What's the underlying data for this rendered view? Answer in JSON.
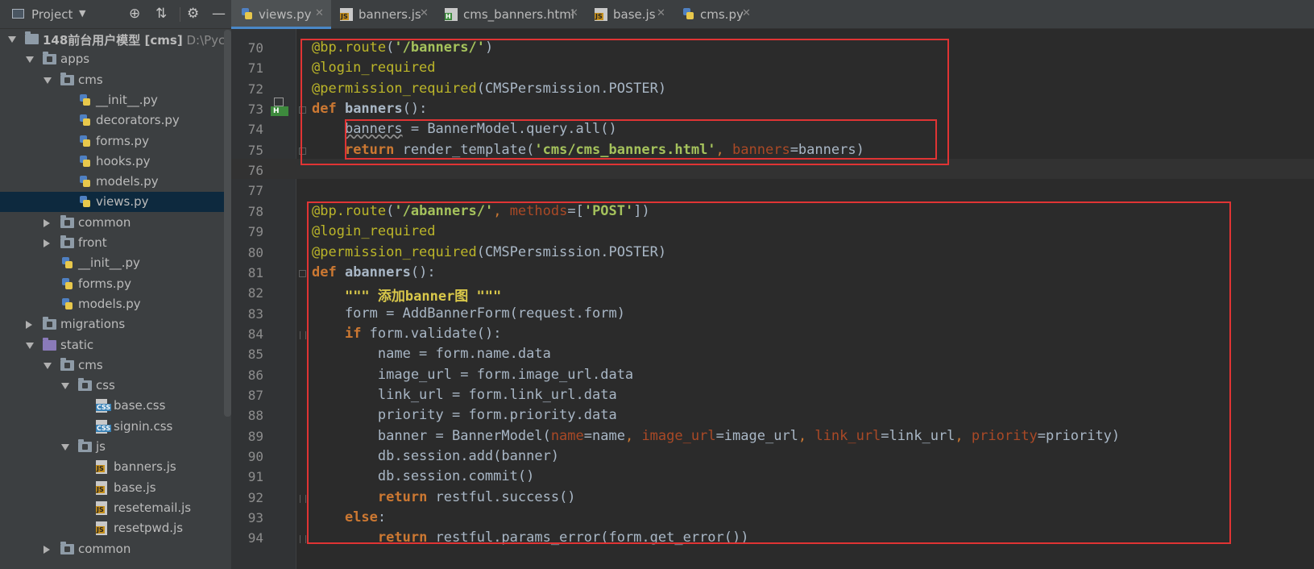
{
  "sidebar": {
    "title": "Project",
    "tree": [
      {
        "label": "148前台用户模型 [cms]",
        "hint": "D:\\Pycharm",
        "type": "folder",
        "expanded": true,
        "depth": 0
      },
      {
        "label": "apps",
        "type": "folder",
        "expanded": true,
        "depth": 1
      },
      {
        "label": "cms",
        "type": "folder",
        "expanded": true,
        "depth": 2
      },
      {
        "label": "__init__.py",
        "type": "py",
        "depth": 3
      },
      {
        "label": "decorators.py",
        "type": "py",
        "depth": 3
      },
      {
        "label": "forms.py",
        "type": "py",
        "depth": 3
      },
      {
        "label": "hooks.py",
        "type": "py",
        "depth": 3
      },
      {
        "label": "models.py",
        "type": "py",
        "depth": 3
      },
      {
        "label": "views.py",
        "type": "py",
        "depth": 3,
        "selected": true
      },
      {
        "label": "common",
        "type": "folder",
        "expanded": false,
        "depth": 2
      },
      {
        "label": "front",
        "type": "folder",
        "expanded": false,
        "depth": 2
      },
      {
        "label": "__init__.py",
        "type": "py",
        "depth": 2
      },
      {
        "label": "forms.py",
        "type": "py",
        "depth": 2
      },
      {
        "label": "models.py",
        "type": "py",
        "depth": 2
      },
      {
        "label": "migrations",
        "type": "folder",
        "expanded": false,
        "depth": 1
      },
      {
        "label": "static",
        "type": "static-folder",
        "expanded": true,
        "depth": 1
      },
      {
        "label": "cms",
        "type": "folder",
        "expanded": true,
        "depth": 2
      },
      {
        "label": "css",
        "type": "folder",
        "expanded": true,
        "depth": 3
      },
      {
        "label": "base.css",
        "type": "css",
        "depth": 4
      },
      {
        "label": "signin.css",
        "type": "css",
        "depth": 4
      },
      {
        "label": "js",
        "type": "folder",
        "expanded": true,
        "depth": 3
      },
      {
        "label": "banners.js",
        "type": "js",
        "depth": 4
      },
      {
        "label": "base.js",
        "type": "js",
        "depth": 4
      },
      {
        "label": "resetemail.js",
        "type": "js",
        "depth": 4
      },
      {
        "label": "resetpwd.js",
        "type": "js",
        "depth": 4
      },
      {
        "label": "common",
        "type": "folder",
        "expanded": false,
        "depth": 2
      }
    ]
  },
  "tabs": [
    {
      "label": "views.py",
      "icon": "python-file-icon",
      "active": true
    },
    {
      "label": "banners.js",
      "icon": "js-file-icon",
      "active": false
    },
    {
      "label": "cms_banners.html",
      "icon": "html-file-icon",
      "active": false
    },
    {
      "label": "base.js",
      "icon": "js-file-icon",
      "active": false
    },
    {
      "label": "cms.py",
      "icon": "python-file-icon",
      "active": false
    }
  ],
  "editor": {
    "current_line": 76,
    "lines": [
      {
        "n": "70",
        "tokens": [
          [
            "deco",
            "@bp.route"
          ],
          [
            "plain",
            "("
          ],
          [
            "str",
            "'/banners/'"
          ],
          [
            "plain",
            ")"
          ]
        ]
      },
      {
        "n": "71",
        "tokens": [
          [
            "deco",
            "@login_required"
          ]
        ]
      },
      {
        "n": "72",
        "tokens": [
          [
            "deco",
            "@permission_required"
          ],
          [
            "plain",
            "(CMSPersmission.POSTER)"
          ]
        ]
      },
      {
        "n": "73",
        "tokens": [
          [
            "kw",
            "def "
          ],
          [
            "bfn",
            "banners"
          ],
          [
            "plain",
            "():"
          ]
        ]
      },
      {
        "n": "74",
        "tokens": [
          [
            "plain",
            "    "
          ],
          [
            "warn",
            "banners"
          ],
          [
            "plain",
            " = BannerModel.query.all()"
          ]
        ]
      },
      {
        "n": "75",
        "tokens": [
          [
            "plain",
            "    "
          ],
          [
            "kw",
            "return "
          ],
          [
            "plain",
            "render_template("
          ],
          [
            "str",
            "'cms/cms_banners.html'"
          ],
          [
            "punct",
            ", "
          ],
          [
            "param",
            "banners"
          ],
          [
            "plain",
            "=banners)"
          ]
        ]
      },
      {
        "n": "76",
        "tokens": []
      },
      {
        "n": "77",
        "tokens": []
      },
      {
        "n": "78",
        "tokens": [
          [
            "deco",
            "@bp.route"
          ],
          [
            "plain",
            "("
          ],
          [
            "str",
            "'/abanners/'"
          ],
          [
            "punct",
            ", "
          ],
          [
            "param",
            "methods"
          ],
          [
            "plain",
            "=["
          ],
          [
            "str",
            "'POST'"
          ],
          [
            "plain",
            "])"
          ]
        ]
      },
      {
        "n": "79",
        "tokens": [
          [
            "deco",
            "@login_required"
          ]
        ]
      },
      {
        "n": "80",
        "tokens": [
          [
            "deco",
            "@permission_required"
          ],
          [
            "plain",
            "(CMSPersmission.POSTER)"
          ]
        ]
      },
      {
        "n": "81",
        "tokens": [
          [
            "kw",
            "def "
          ],
          [
            "bfn",
            "abanners"
          ],
          [
            "plain",
            "():"
          ]
        ]
      },
      {
        "n": "82",
        "tokens": [
          [
            "plain",
            "    "
          ],
          [
            "doc",
            "\"\"\" 添加banner图 \"\"\""
          ]
        ]
      },
      {
        "n": "83",
        "tokens": [
          [
            "plain",
            "    form = AddBannerForm(request.form)"
          ]
        ]
      },
      {
        "n": "84",
        "tokens": [
          [
            "plain",
            "    "
          ],
          [
            "kw",
            "if "
          ],
          [
            "plain",
            "form.validate():"
          ]
        ]
      },
      {
        "n": "85",
        "tokens": [
          [
            "plain",
            "        name = form.name.data"
          ]
        ]
      },
      {
        "n": "86",
        "tokens": [
          [
            "plain",
            "        image_url = form.image_url.data"
          ]
        ]
      },
      {
        "n": "87",
        "tokens": [
          [
            "plain",
            "        link_url = form.link_url.data"
          ]
        ]
      },
      {
        "n": "88",
        "tokens": [
          [
            "plain",
            "        priority = form.priority.data"
          ]
        ]
      },
      {
        "n": "89",
        "tokens": [
          [
            "plain",
            "        banner = BannerModel("
          ],
          [
            "param",
            "name"
          ],
          [
            "plain",
            "=name"
          ],
          [
            "punct",
            ", "
          ],
          [
            "param",
            "image_url"
          ],
          [
            "plain",
            "=image_url"
          ],
          [
            "punct",
            ", "
          ],
          [
            "param",
            "link_url"
          ],
          [
            "plain",
            "=link_url"
          ],
          [
            "punct",
            ", "
          ],
          [
            "param",
            "priority"
          ],
          [
            "plain",
            "=priority)"
          ]
        ]
      },
      {
        "n": "90",
        "tokens": [
          [
            "plain",
            "        db.session.add(banner)"
          ]
        ]
      },
      {
        "n": "91",
        "tokens": [
          [
            "plain",
            "        db.session.commit()"
          ]
        ]
      },
      {
        "n": "92",
        "tokens": [
          [
            "plain",
            "        "
          ],
          [
            "kw",
            "return "
          ],
          [
            "plain",
            "restful.success()"
          ]
        ]
      },
      {
        "n": "93",
        "tokens": [
          [
            "plain",
            "    "
          ],
          [
            "kw",
            "else"
          ],
          [
            "plain",
            ":"
          ]
        ]
      },
      {
        "n": "94",
        "tokens": [
          [
            "plain",
            "        "
          ],
          [
            "kw",
            "return "
          ],
          [
            "plain",
            "restful.params_error(form.get_error())"
          ]
        ]
      }
    ]
  },
  "gutter_marker": "H",
  "colors": {
    "highlight_box": "#e03434",
    "selected_row": "#0d293e",
    "accent_tab": "#4a88c7"
  }
}
